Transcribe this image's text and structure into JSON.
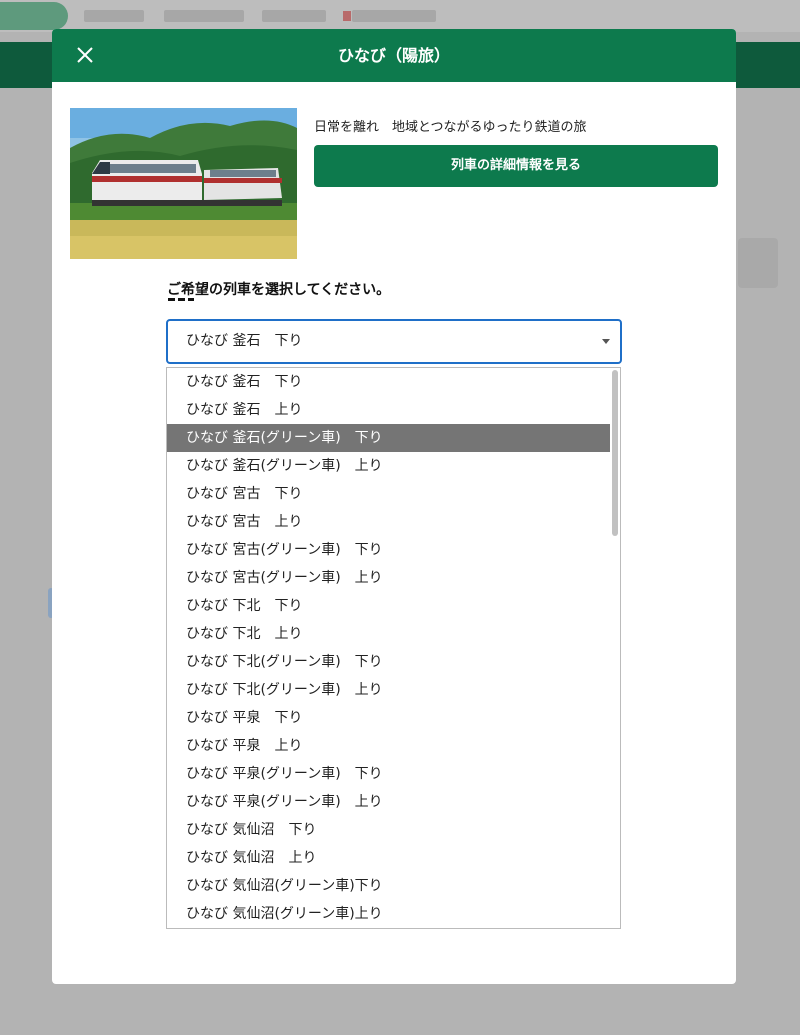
{
  "modal": {
    "title": "ひなび（陽旅）",
    "catchphrase": "日常を離れ　地域とつながるゆったり鉄道の旅",
    "detail_button_label": "列車の詳細情報を見る",
    "select_prompt": "ご希望の列車を選択してください。",
    "close_icon": "close-icon"
  },
  "train_select": {
    "selected": "ひなび 釜石　下り",
    "highlighted_index": 2,
    "options": [
      "ひなび 釜石　下り",
      "ひなび 釜石　上り",
      "ひなび 釜石(グリーン車)　下り",
      "ひなび 釜石(グリーン車)　上り",
      "ひなび 宮古　下り",
      "ひなび 宮古　上り",
      "ひなび 宮古(グリーン車)　下り",
      "ひなび 宮古(グリーン車)　上り",
      "ひなび 下北　下り",
      "ひなび 下北　上り",
      "ひなび 下北(グリーン車)　下り",
      "ひなび 下北(グリーン車)　上り",
      "ひなび 平泉　下り",
      "ひなび 平泉　上り",
      "ひなび 平泉(グリーン車)　下り",
      "ひなび 平泉(グリーン車)　上り",
      "ひなび 気仙沼　下り",
      "ひなび 気仙沼　上り",
      "ひなび 気仙沼(グリーン車)下り",
      "ひなび 気仙沼(グリーン車)上り"
    ]
  },
  "colors": {
    "brand_green": "#0d7a4d",
    "focus_blue": "#1f6fc8",
    "highlight_gray": "#757575"
  }
}
